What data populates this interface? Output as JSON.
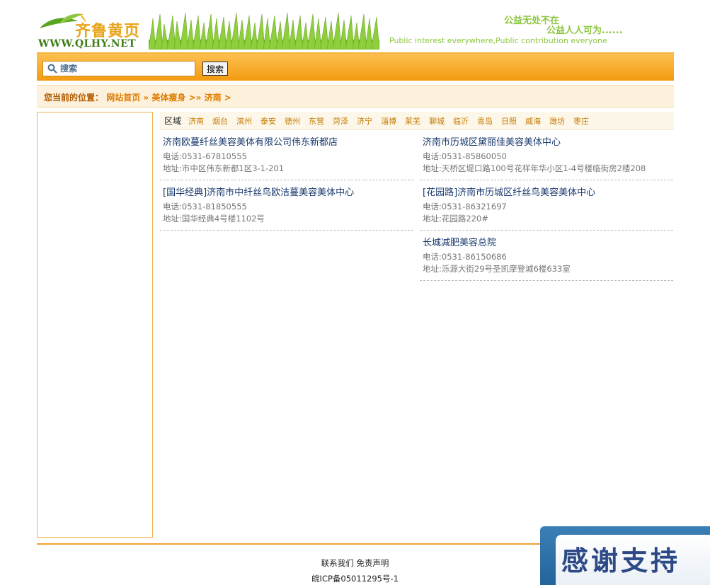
{
  "header": {
    "logo_cn": "齐鲁黄页",
    "logo_en": "WWW.QLHY.NET",
    "slogan_line1": "公益无处不在",
    "slogan_line2": "公益人人可为......",
    "slogan_en": "Public interest everywhere,Public contribution everyone"
  },
  "search": {
    "placeholder": "搜索",
    "button_label": "搜索"
  },
  "breadcrumb": {
    "label": "您当前的位置：",
    "home": "网站首页",
    "sep1": "»",
    "category": "美体瘦身",
    "sep2": ">»",
    "city": "济南",
    "sep3": ">"
  },
  "regions": {
    "title": "区域",
    "items": [
      "济南",
      "烟台",
      "滨州",
      "泰安",
      "德州",
      "东营",
      "菏泽",
      "济宁",
      "淄博",
      "莱芜",
      "聊城",
      "临沂",
      "青岛",
      "日照",
      "威海",
      "潍坊",
      "枣庄"
    ]
  },
  "listings": [
    {
      "title": "济南欧蔓纤丝美容美体有限公司伟东新都店",
      "phone": "电话:0531-67810555",
      "address": "地址:市中区伟东新都1区3-1-201"
    },
    {
      "title": "济南市历城区黛丽佳美容美体中心",
      "phone": "电话:0531-85860050",
      "address": "地址:天桥区堤口路100号花样年华小区1-4号楼临街房2楼208"
    },
    {
      "title": "[国华经典]济南市中纤丝鸟欧洁蔓美容美体中心",
      "phone": "电话:0531-81850555",
      "address": "地址:国华经典4号楼1102号"
    },
    {
      "title": "[花园路]济南市历城区纤丝鸟美容美体中心",
      "phone": "电话:0531-86321697",
      "address": "地址:花园路220#"
    },
    {
      "title": "长城减肥美容总院",
      "phone": "电话:0531-86150686",
      "address": "地址:泺源大街29号圣凯摩登城6楼633室"
    }
  ],
  "footer": {
    "contact": "联系我们",
    "disclaimer": "免责声明",
    "icp": "皖ICP备05011295号-1"
  },
  "banner": {
    "text": "感谢支持"
  }
}
